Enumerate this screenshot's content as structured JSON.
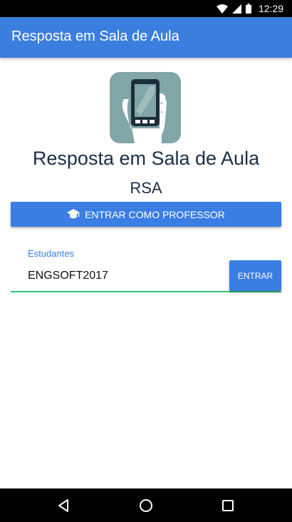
{
  "status_bar": {
    "time": "12:29",
    "icons": [
      "wifi-icon",
      "signal-icon",
      "battery-icon"
    ]
  },
  "app_bar": {
    "title": "Resposta em Sala de Aula"
  },
  "header": {
    "logo_icon": "phone-in-hand-icon",
    "app_name": "Resposta em Sala de Aula",
    "app_abbrev": "RSA"
  },
  "teacher_login": {
    "icon": "graduation-cap-icon",
    "label": "ENTRAR COMO PROFESSOR"
  },
  "student_login": {
    "field_label": "Estudantes",
    "input_value": "ENGSOFT2017",
    "button_label": "ENTRAR"
  },
  "nav_bar": {
    "icons": [
      "back-icon",
      "home-icon",
      "recents-icon"
    ]
  },
  "colors": {
    "primary": "#3c7ee0",
    "accent_underline": "#2ec27e",
    "logo_bg": "#80a6a7",
    "heading_text": "#1b2f46"
  }
}
